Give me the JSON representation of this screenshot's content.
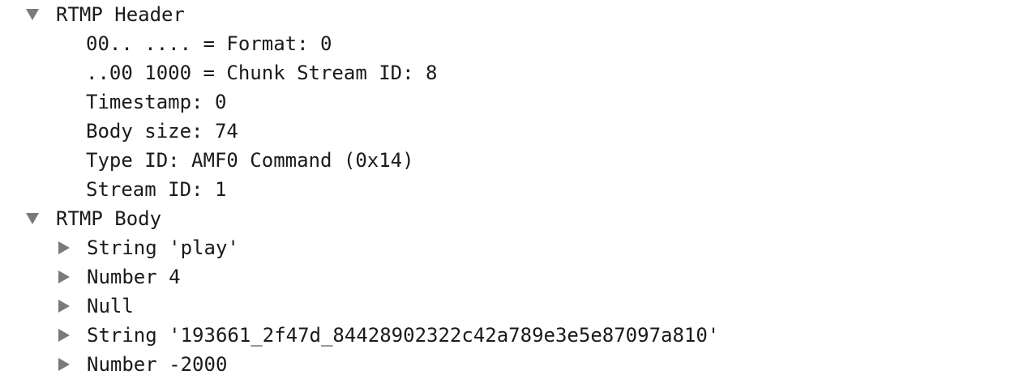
{
  "tree": {
    "header_section": {
      "label": "RTMP Header",
      "state": "expanded",
      "fields": [
        "00.. .... = Format: 0",
        "..00 1000 = Chunk Stream ID: 8",
        "Timestamp: 0",
        "Body size: 74",
        "Type ID: AMF0 Command (0x14)",
        "Stream ID: 1"
      ]
    },
    "body_section": {
      "label": "RTMP Body",
      "state": "expanded",
      "items": [
        "String 'play'",
        "Number 4",
        "Null",
        "String '193661_2f47d_84428902322c42a789e3e5e87097a810'",
        "Number -2000"
      ]
    }
  },
  "icons": {
    "expanded": "triangle-down-icon",
    "collapsed": "triangle-right-icon"
  },
  "colors": {
    "text": "#1a1a1a",
    "toggle": "#7a7a7a",
    "background": "#ffffff"
  }
}
